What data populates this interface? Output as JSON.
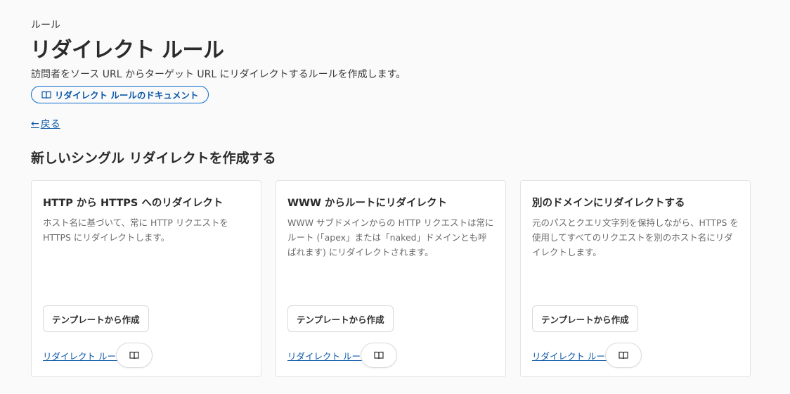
{
  "header": {
    "breadcrumb": "ルール",
    "title": "リダイレクト ルール",
    "description": "訪問者をソース URL からターゲット URL にリダイレクトするルールを作成します。",
    "docs_link": "リダイレクト ルールのドキュメント",
    "back_link": "戻る"
  },
  "section": {
    "title": "新しいシングル リダイレクトを作成する"
  },
  "cards": [
    {
      "title": "HTTP から HTTPS へのリダイレクト",
      "description": "ホスト名に基づいて、常に HTTP リクエストを HTTPS にリダイレクトします。",
      "button": "テンプレートから作成",
      "link": "リダイレクト ルール"
    },
    {
      "title": "WWW からルートにリダイレクト",
      "description": "WWW サブドメインからの HTTP リクエストは常にルート (「apex」または「naked」ドメインとも呼ばれます) にリダイレクトされます。",
      "button": "テンプレートから作成",
      "link": "リダイレクト ルール"
    },
    {
      "title": "別のドメインにリダイレクトする",
      "description": "元のパスとクエリ文字列を保持しながら、HTTPS を使用してすべてのリクエストを別のホスト名にリダイレクトします。",
      "button": "テンプレートから作成",
      "link": "リダイレクト ルール"
    }
  ],
  "icons": {
    "docs": "book-icon",
    "back": "arrow-left-icon"
  },
  "colors": {
    "link": "#0b57a8",
    "background": "#fafafa",
    "card": "#ffffff"
  }
}
